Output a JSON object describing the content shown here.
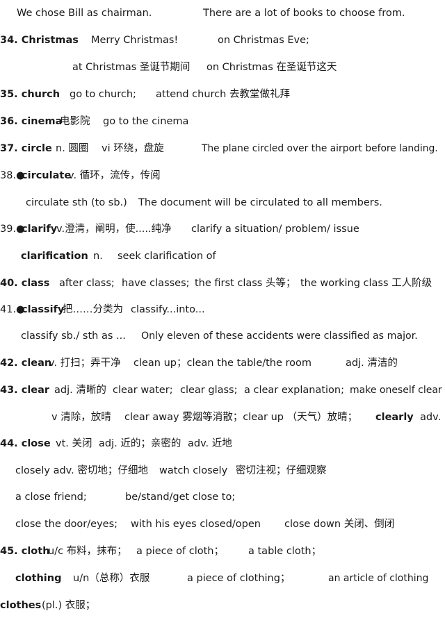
{
  "lines": [
    {
      "segments": [
        "We chose Bill as chairman.",
        "There are a lot of books to choose from."
      ]
    },
    {
      "head": "34. Christmas",
      "segments": [
        "Merry Christmas!",
        "on Christmas Eve;"
      ]
    },
    {
      "segments": [
        "at Christmas 圣诞节期间",
        "on Christmas 在圣诞节这天"
      ]
    },
    {
      "head": "35. church",
      "segments": [
        "go to church;",
        "attend church 去教堂做礼拜"
      ]
    },
    {
      "head": "36. cinema",
      "segments": [
        "电影院",
        "go to the cinema"
      ]
    },
    {
      "head": "37. circle",
      "segments": [
        "n. 圆圈",
        "vi 环绕，盘旋",
        "The plane circled over the airport before landing."
      ]
    },
    {
      "prefix": "38.●",
      "head": "circulate",
      "segments": [
        "v. 循环，流传，传阅"
      ]
    },
    {
      "segments": [
        "circulate sth (to sb.)",
        "The document will be circulated to all members."
      ]
    },
    {
      "prefix": "39.●",
      "head": "clarify",
      "segments": [
        "v.澄清，阐明，使.....纯净",
        "clarify a situation/ problem/ issue"
      ]
    },
    {
      "head": "clarification",
      "segments": [
        "n.",
        "seek clarification of"
      ]
    },
    {
      "head": "40. class",
      "segments": [
        "after class;",
        "have classes;",
        "the first class 头等；",
        "the working class 工人阶级"
      ]
    },
    {
      "prefix": "41.●",
      "head": "classify",
      "segments": [
        "把……分类为",
        "classify...into..."
      ]
    },
    {
      "segments": [
        "classify sb./ sth as ...",
        "Only eleven of these accidents were classified as major."
      ]
    },
    {
      "head": "42. clean",
      "segments": [
        "v. 打扫；弄干净",
        "clean up；clean the table/the room",
        "adj. 清洁的"
      ]
    },
    {
      "head": "43. clear",
      "segments": [
        "adj. 清晰的",
        "clear water;",
        "clear glass;",
        "a clear explanation;",
        "make oneself clear"
      ]
    },
    {
      "segments": [
        "v 清除，放晴",
        "clear away 雾烟等消散；clear up （天气）放晴；",
        "clearly",
        "adv."
      ]
    },
    {
      "head": "44. close",
      "segments": [
        "vt. 关闭",
        "adj. 近的；亲密的",
        "adv. 近地"
      ]
    },
    {
      "segments": [
        "closely adv. 密切地；仔细地",
        "watch closely",
        "密切注视；仔细观察"
      ]
    },
    {
      "segments": [
        "a close friend;",
        "be/stand/get close to;"
      ]
    },
    {
      "segments": [
        "close the door/eyes;",
        "with his eyes closed/open",
        "close down 关闭、倒闭"
      ]
    },
    {
      "head": "45. cloth",
      "segments": [
        "u/c 布料，抹布；",
        "a piece of cloth；",
        "a table cloth；"
      ]
    },
    {
      "head": "clothing",
      "segments": [
        "u/n（总称）衣服",
        "a  piece  of  clothing；",
        "an  article  of  clothing"
      ]
    },
    {
      "head": "clothes",
      "segments": [
        "(pl.) 衣服；"
      ]
    }
  ]
}
